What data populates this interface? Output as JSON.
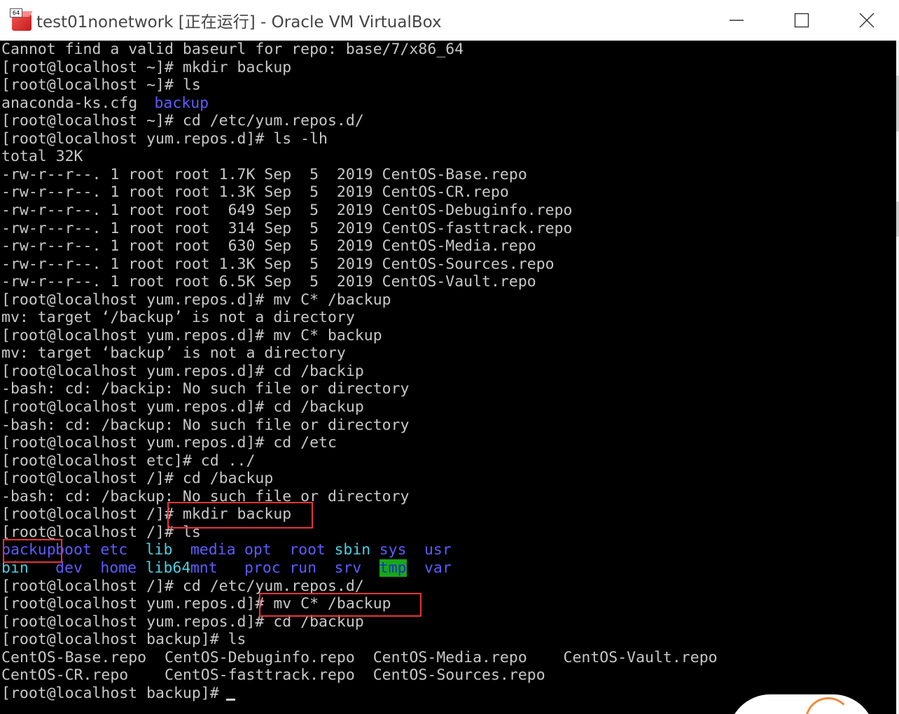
{
  "window": {
    "title": "test01nonetwork [正在运行] - Oracle VM VirtualBox",
    "icon_badge": "64",
    "icon": "virtualbox-icon",
    "controls": [
      "minimize-icon",
      "maximize-icon",
      "close-icon"
    ]
  },
  "terminal": {
    "lines": [
      "Cannot find a valid baseurl for repo: base/7/x86_64",
      "[root@localhost ~]# mkdir backup",
      "[root@localhost ~]# ls",
      null,
      "[root@localhost ~]# cd /etc/yum.repos.d/",
      "[root@localhost yum.repos.d]# ls -lh",
      "total 32K",
      "-rw-r--r--. 1 root root 1.7K Sep  5  2019 CentOS-Base.repo",
      "-rw-r--r--. 1 root root 1.3K Sep  5  2019 CentOS-CR.repo",
      "-rw-r--r--. 1 root root  649 Sep  5  2019 CentOS-Debuginfo.repo",
      "-rw-r--r--. 1 root root  314 Sep  5  2019 CentOS-fasttrack.repo",
      "-rw-r--r--. 1 root root  630 Sep  5  2019 CentOS-Media.repo",
      "-rw-r--r--. 1 root root 1.3K Sep  5  2019 CentOS-Sources.repo",
      "-rw-r--r--. 1 root root 6.5K Sep  5  2019 CentOS-Vault.repo",
      "[root@localhost yum.repos.d]# mv C* /backup",
      "mv: target ‘/backup’ is not a directory",
      "[root@localhost yum.repos.d]# mv C* backup",
      "mv: target ‘backup’ is not a directory",
      "[root@localhost yum.repos.d]# cd /backip",
      "-bash: cd: /backip: No such file or directory",
      "[root@localhost yum.repos.d]# cd /backup",
      "-bash: cd: /backup: No such file or directory",
      "[root@localhost yum.repos.d]# cd /etc",
      "[root@localhost etc]# cd ../",
      "[root@localhost /]# cd /backup",
      "-bash: cd: /backup: No such file or directory",
      "[root@localhost /]# mkdir backup",
      "[root@localhost /]# ls",
      null,
      null,
      "[root@localhost /]# cd /etc/yum.repos.d/",
      "[root@localhost yum.repos.d]# mv C* /backup",
      "[root@localhost yum.repos.d]# cd /backup",
      "[root@localhost backup]# ls",
      "CentOS-Base.repo  CentOS-Debuginfo.repo  CentOS-Media.repo    CentOS-Vault.repo",
      "CentOS-CR.repo    CentOS-fasttrack.repo  CentOS-Sources.repo",
      "[root@localhost backup]# "
    ],
    "home_listing": {
      "file": "anaconda-ks.cfg",
      "dir": "backup"
    },
    "root_listing_row1": [
      {
        "text": "backup",
        "col": 0,
        "style": "blue"
      },
      {
        "text": "boot",
        "col": 6,
        "style": "blue"
      },
      {
        "text": "etc",
        "col": 11,
        "style": "blue"
      },
      {
        "text": "lib",
        "col": 16,
        "style": "cyan"
      },
      {
        "text": "media",
        "col": 21,
        "style": "blue"
      },
      {
        "text": "opt",
        "col": 27,
        "style": "blue"
      },
      {
        "text": "root",
        "col": 32,
        "style": "blue"
      },
      {
        "text": "sbin",
        "col": 37,
        "style": "cyan"
      },
      {
        "text": "sys",
        "col": 42,
        "style": "blue"
      },
      {
        "text": "usr",
        "col": 47,
        "style": "blue"
      }
    ],
    "root_listing_row2": [
      {
        "text": "bin",
        "col": 0,
        "style": "cyan"
      },
      {
        "text": "dev",
        "col": 6,
        "style": "blue"
      },
      {
        "text": "home",
        "col": 11,
        "style": "blue"
      },
      {
        "text": "lib64",
        "col": 16,
        "style": "cyan"
      },
      {
        "text": "mnt",
        "col": 21,
        "style": "blue"
      },
      {
        "text": "proc",
        "col": 27,
        "style": "blue"
      },
      {
        "text": "run",
        "col": 32,
        "style": "blue"
      },
      {
        "text": "srv",
        "col": 37,
        "style": "blue"
      },
      {
        "text": "tmp",
        "col": 42,
        "style": "tmp"
      },
      {
        "text": "var",
        "col": 47,
        "style": "blue"
      }
    ]
  },
  "colors": {
    "terminal_bg": "#000000",
    "terminal_fg": "#c8c8c8",
    "dir_blue": "#5c5cff",
    "link_cyan": "#4ad0e0",
    "tmp_bg": "#17a817",
    "highlight_red": "#e8333a"
  }
}
